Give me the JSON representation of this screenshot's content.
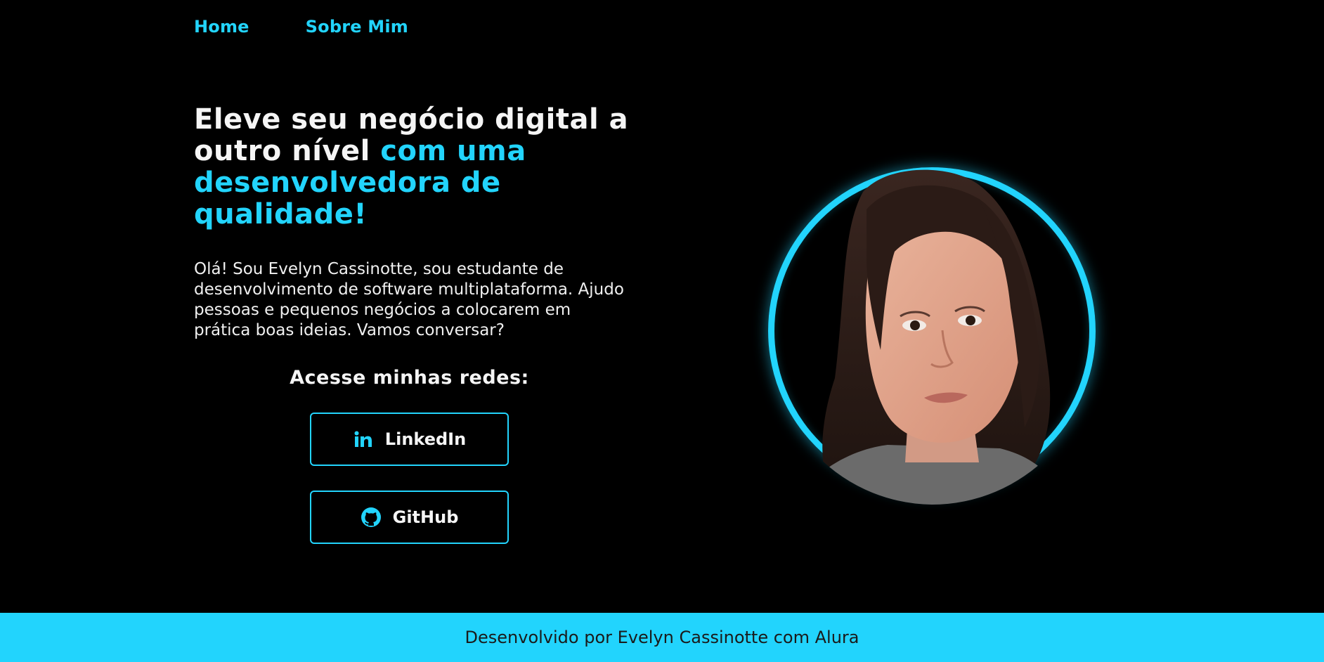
{
  "nav": {
    "items": [
      {
        "label": "Home"
      },
      {
        "label": "Sobre Mim"
      }
    ]
  },
  "hero": {
    "headline_part1": "Eleve seu negócio digital a outro nível ",
    "headline_accent": "com uma desenvolvedora de qualidade!",
    "intro": "Olá! Sou Evelyn Cassinotte, sou estudante de desenvolvimento de software multiplataforma. Ajudo pessoas e pequenos negócios a colocarem em prática boas ideias. Vamos conversar?",
    "socials_title": "Acesse minhas redes:",
    "socials": [
      {
        "label": "LinkedIn",
        "icon": "linkedin-icon"
      },
      {
        "label": "GitHub",
        "icon": "github-icon"
      }
    ]
  },
  "portrait": {
    "description_icon": "profile-photo"
  },
  "footer": {
    "text": "Desenvolvido por Evelyn Cassinotte com Alura"
  },
  "colors": {
    "background": "#000000",
    "accent": "#22d4fd",
    "text": "#f5f5f5",
    "footer_text": "#1a1a1a"
  }
}
